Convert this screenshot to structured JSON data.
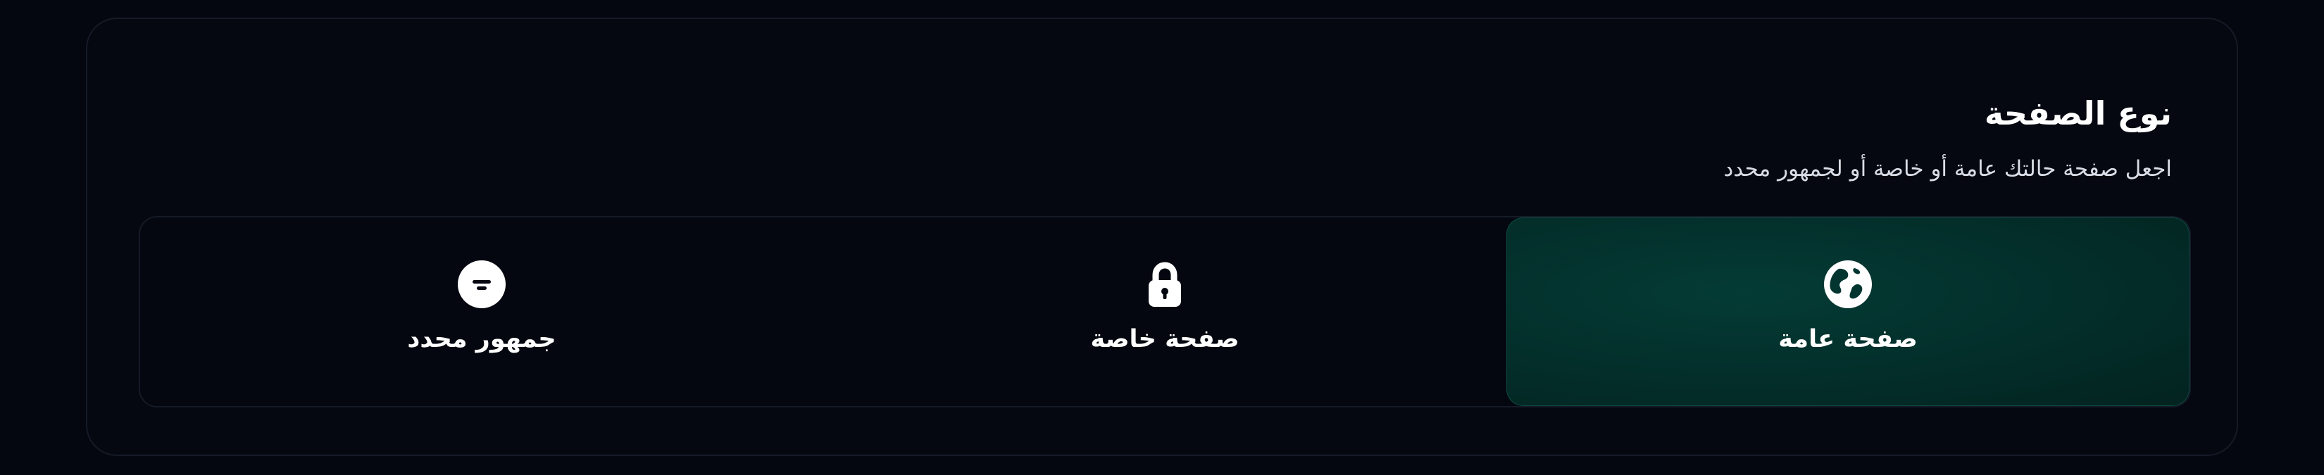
{
  "section": {
    "title": "نوع الصفحة",
    "subtitle": "اجعل صفحة حالتك عامة أو خاصة أو لجمهور محدد"
  },
  "options": [
    {
      "label": "صفحة عامة",
      "icon": "globe-icon",
      "selected": true
    },
    {
      "label": "صفحة خاصة",
      "icon": "lock-icon",
      "selected": false
    },
    {
      "label": "جمهور محدد",
      "icon": "filter-icon",
      "selected": false
    }
  ],
  "colors": {
    "background": "#04070f",
    "card": "#050811",
    "border": "#151a27",
    "selected": "#033530",
    "text": "#ffffff"
  }
}
